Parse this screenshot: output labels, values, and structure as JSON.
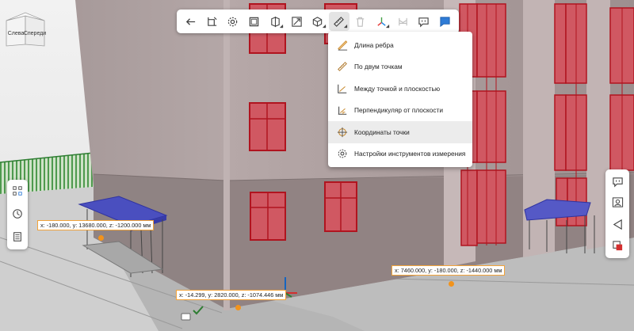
{
  "view_cube": {
    "face_left": "Слева",
    "face_front": "Спереди"
  },
  "toolbar": {
    "buttons": [
      {
        "icon": "back-arrow-icon"
      },
      {
        "icon": "crop-icon"
      },
      {
        "icon": "settings-gear-icon"
      },
      {
        "icon": "section-box-icon"
      },
      {
        "icon": "section-plane-icon"
      },
      {
        "icon": "fit-view-icon"
      },
      {
        "icon": "model-cube-icon"
      },
      {
        "icon": "ruler-icon",
        "active": true
      },
      {
        "icon": "trash-icon",
        "disabled": true
      },
      {
        "icon": "axes-icon"
      },
      {
        "icon": "level-icon",
        "disabled": true
      },
      {
        "icon": "comment-icon"
      },
      {
        "icon": "chat-bubble-icon"
      }
    ]
  },
  "measure_menu": {
    "items": [
      {
        "label": "Длина ребра",
        "icon": "edge-length-icon"
      },
      {
        "label": "По двум точкам",
        "icon": "two-points-icon"
      },
      {
        "label": "Между точкой и плоскостью",
        "icon": "point-plane-icon"
      },
      {
        "label": "Перпендикуляр от плоскости",
        "icon": "perpendicular-icon"
      },
      {
        "label": "Координаты точки",
        "icon": "point-coordinates-icon",
        "highlighted": true
      },
      {
        "label": "Настройки инструментов измерения",
        "icon": "measure-settings-icon"
      }
    ]
  },
  "coordinates": [
    {
      "text": "x: -180.000, y: 13680.000, z: -1200.000 мм"
    },
    {
      "text": "x: 7460.000, y: -180.000, z: -1440.000 мм"
    },
    {
      "text": "x: -14.299, y: 2820.000, z: -1074.446 мм"
    }
  ],
  "colors": {
    "accent": "#2e7bd6",
    "coord_border": "#f2a33a",
    "coord_point": "#f2931c",
    "window_frame": "#c8232e"
  }
}
